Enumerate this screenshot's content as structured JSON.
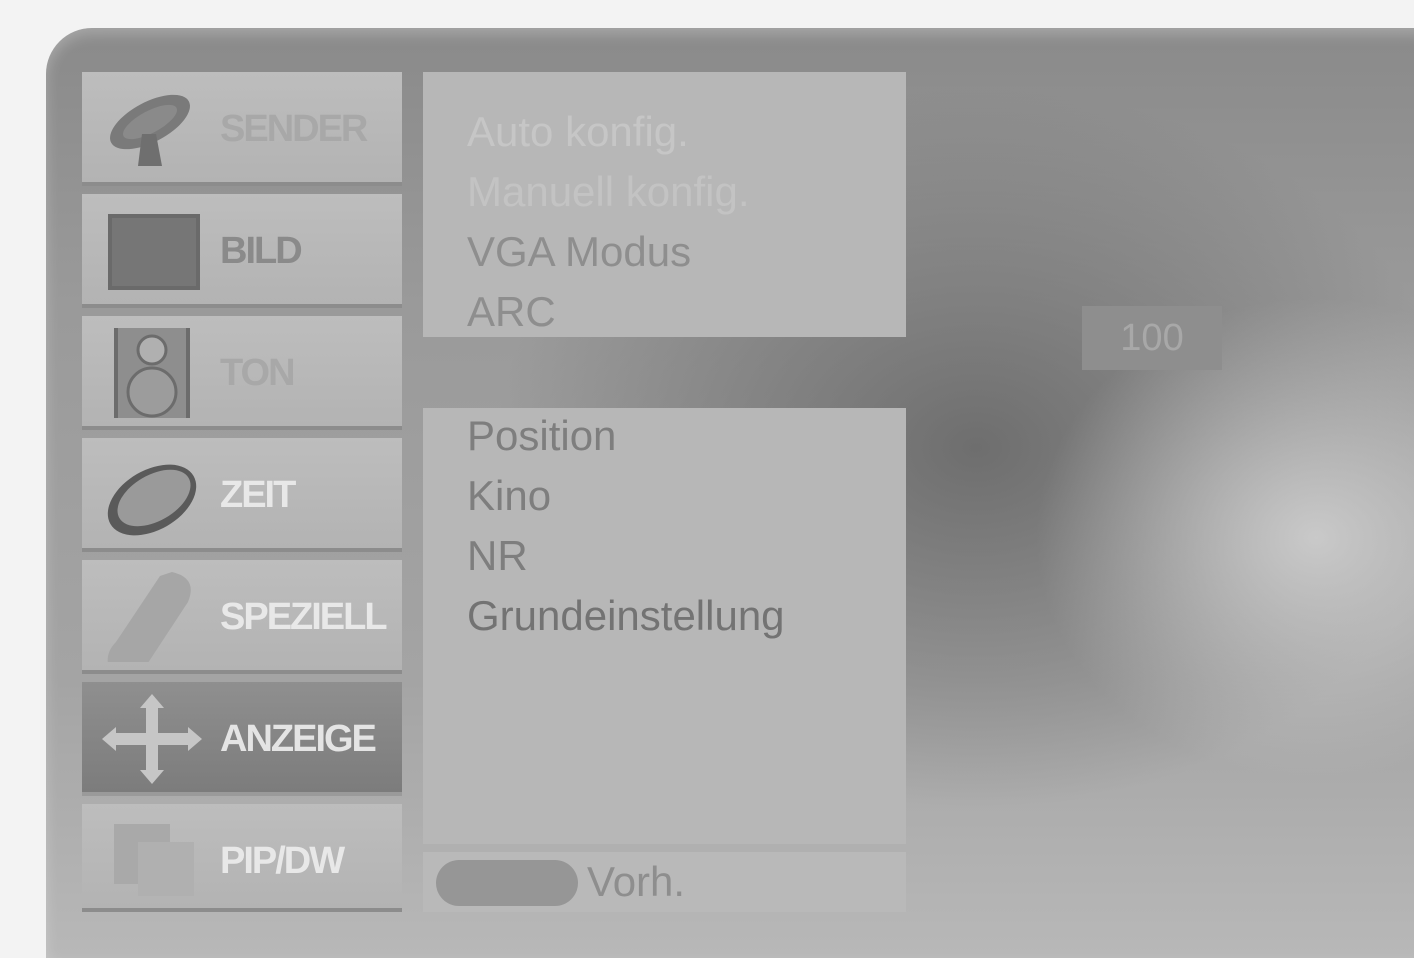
{
  "sidebar": {
    "items": [
      {
        "label": "SENDER",
        "icon": "satellite-dish-icon",
        "state": "dim"
      },
      {
        "label": "BILD",
        "icon": "picture-screen-icon",
        "state": "normal"
      },
      {
        "label": "TON",
        "icon": "speaker-icon",
        "state": "dim"
      },
      {
        "label": "ZEIT",
        "icon": "clock-icon",
        "state": "light"
      },
      {
        "label": "SPEZIELL",
        "icon": "remote-icon",
        "state": "light"
      },
      {
        "label": "ANZEIGE",
        "icon": "move-arrows-icon",
        "state": "active"
      },
      {
        "label": "PIP/DW",
        "icon": "pip-icon",
        "state": "light"
      }
    ]
  },
  "menu": {
    "top_items": [
      "Auto konfig.",
      "Manuell konfig.",
      "VGA Modus",
      "ARC"
    ],
    "bottom_items": [
      "Position",
      "Kino",
      "NR",
      "Grundeinstellung"
    ],
    "value": "100",
    "prev_label": "Vorh."
  }
}
